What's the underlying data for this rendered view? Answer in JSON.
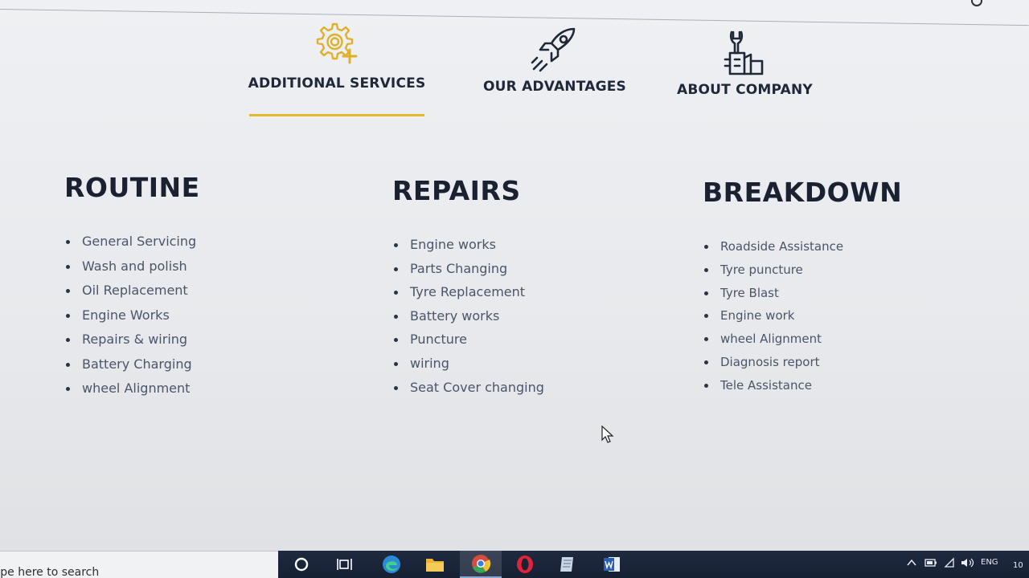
{
  "tabs": [
    {
      "label": "ADDITIONAL SERVICES",
      "active": true,
      "icon": "gear-plus-icon"
    },
    {
      "label": "OUR ADVANTAGES",
      "active": false,
      "icon": "rocket-icon"
    },
    {
      "label": "ABOUT COMPANY",
      "active": false,
      "icon": "wrench-hand-icon"
    }
  ],
  "colors": {
    "accent": "#e3b82a",
    "heading": "#1a2231",
    "list_text": "#4a5569",
    "taskbar": "#1f2a3f"
  },
  "columns": [
    {
      "title": "ROUTINE",
      "items": [
        "General Servicing",
        "Wash and polish",
        "Oil Replacement",
        "Engine Works",
        "Repairs & wiring",
        "Battery Charging",
        "wheel Alignment"
      ]
    },
    {
      "title": "REPAIRS",
      "items": [
        "Engine works",
        "Parts Changing",
        "Tyre Replacement",
        "Battery works",
        "Puncture",
        "wiring",
        "Seat Cover changing"
      ]
    },
    {
      "title": "BREAKDOWN",
      "items": [
        "Roadside Assistance",
        "Tyre puncture",
        "Tyre Blast",
        "Engine work",
        "wheel Alignment",
        "Diagnosis report",
        "Tele Assistance"
      ]
    }
  ],
  "taskbar": {
    "search_placeholder": "ype here to search",
    "apps": [
      "cortana-icon",
      "task-view-icon",
      "edge-icon",
      "file-explorer-icon",
      "chrome-icon",
      "opera-icon",
      "notes-app-icon",
      "word-icon"
    ],
    "tray_language": "ENG",
    "clock_partial": "10"
  }
}
